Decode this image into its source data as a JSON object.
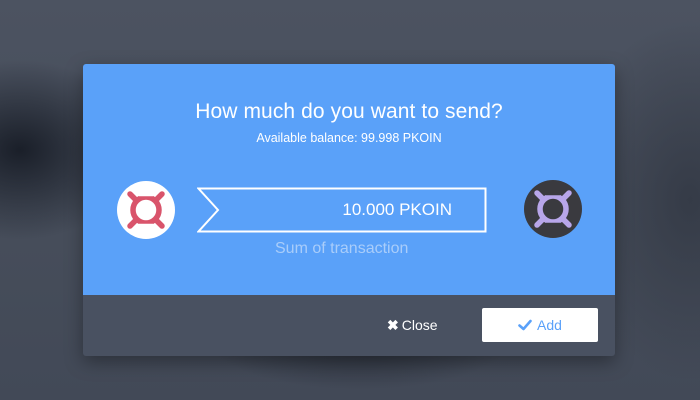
{
  "dialog": {
    "title": "How much do you want to send?",
    "balance_text": "Available balance: 99.998 PKOIN",
    "amount_value": "10.000 PKOIN",
    "amount_caption": "Sum of transaction",
    "close_label": "Close",
    "add_label": "Add",
    "from_icon": "pkoin-logo-icon",
    "to_icon": "pkoin-logo-icon",
    "close_icon": "close-icon",
    "add_icon": "checkmark-icon"
  },
  "colors": {
    "accent": "#5aa1f9",
    "background": "#444b58",
    "from_logo": "#d9546b",
    "to_logo": "#b8a6ea"
  }
}
